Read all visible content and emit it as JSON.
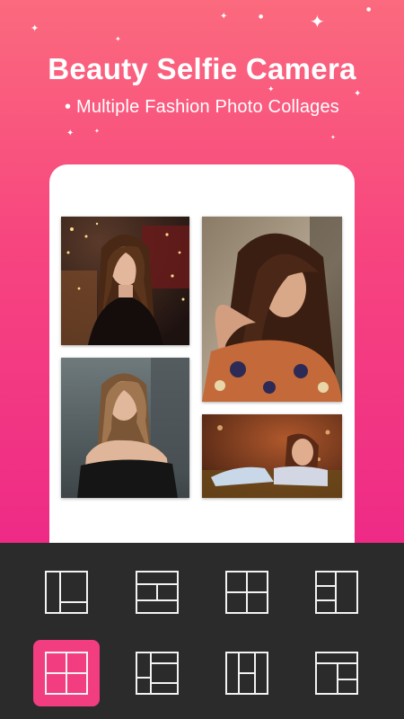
{
  "header": {
    "title": "Beauty Selfie Camera",
    "subtitle": "• Multiple Fashion Photo Collages"
  },
  "collage": {
    "photos": [
      {
        "name": "photo-woman-fairy-lights"
      },
      {
        "name": "photo-woman-floral-blouse"
      },
      {
        "name": "photo-woman-black-top"
      },
      {
        "name": "photo-woman-lying-grass"
      }
    ]
  },
  "layouts": {
    "selected_index": 4,
    "items": [
      {
        "name": "layout-icon-1"
      },
      {
        "name": "layout-icon-2"
      },
      {
        "name": "layout-icon-3"
      },
      {
        "name": "layout-icon-4"
      },
      {
        "name": "layout-icon-5"
      },
      {
        "name": "layout-icon-6"
      },
      {
        "name": "layout-icon-7"
      },
      {
        "name": "layout-icon-8"
      }
    ]
  },
  "colors": {
    "gradient_top": "#fb6a7e",
    "gradient_bottom": "#ee2a86",
    "accent": "#f23d80",
    "toolbar_bg": "#2b2b2b"
  }
}
